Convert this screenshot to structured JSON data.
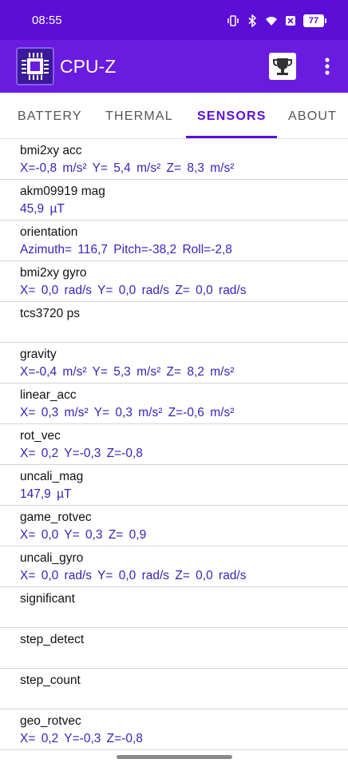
{
  "status_bar": {
    "time": "08:55",
    "battery": "77",
    "icons": [
      "vibrate-icon",
      "bluetooth-icon",
      "wifi-icon",
      "data-saver-icon",
      "battery-icon"
    ]
  },
  "app_bar": {
    "title": "CPU-Z",
    "colors": {
      "status": "#5b0fd6",
      "bar": "#6a1be0",
      "accent": "#5b0fd6",
      "value_text": "#3a1fb8"
    }
  },
  "tabs": [
    {
      "label": "BATTERY",
      "active": false
    },
    {
      "label": "THERMAL",
      "active": false
    },
    {
      "label": "SENSORS",
      "active": true
    },
    {
      "label": "ABOUT",
      "active": false
    }
  ],
  "sensors": [
    {
      "name": "bmi2xy acc",
      "value": "X=-0,8 m/s²  Y= 5,4 m/s²  Z= 8,3 m/s²"
    },
    {
      "name": "akm09919 mag",
      "value": "45,9 µT"
    },
    {
      "name": "orientation",
      "value": "Azimuth= 116,7  Pitch=-38,2  Roll=-2,8"
    },
    {
      "name": "bmi2xy gyro",
      "value": "X= 0,0 rad/s  Y= 0,0 rad/s  Z= 0,0 rad/s"
    },
    {
      "name": "tcs3720 ps",
      "value": ""
    },
    {
      "name": "gravity",
      "value": "X=-0,4 m/s²  Y= 5,3 m/s²  Z= 8,2 m/s²"
    },
    {
      "name": "linear_acc",
      "value": "X= 0,3 m/s²  Y= 0,3 m/s²  Z=-0,6 m/s²"
    },
    {
      "name": "rot_vec",
      "value": "X= 0,2  Y=-0,3  Z=-0,8"
    },
    {
      "name": "uncali_mag",
      "value": "147,9 µT"
    },
    {
      "name": "game_rotvec",
      "value": "X= 0,0  Y= 0,3  Z= 0,9"
    },
    {
      "name": "uncali_gyro",
      "value": "X= 0,0 rad/s  Y= 0,0 rad/s  Z= 0,0 rad/s"
    },
    {
      "name": "significant",
      "value": ""
    },
    {
      "name": "step_detect",
      "value": ""
    },
    {
      "name": "step_count",
      "value": ""
    },
    {
      "name": "geo_rotvec",
      "value": "X= 0,2  Y=-0,3  Z=-0,8"
    }
  ]
}
